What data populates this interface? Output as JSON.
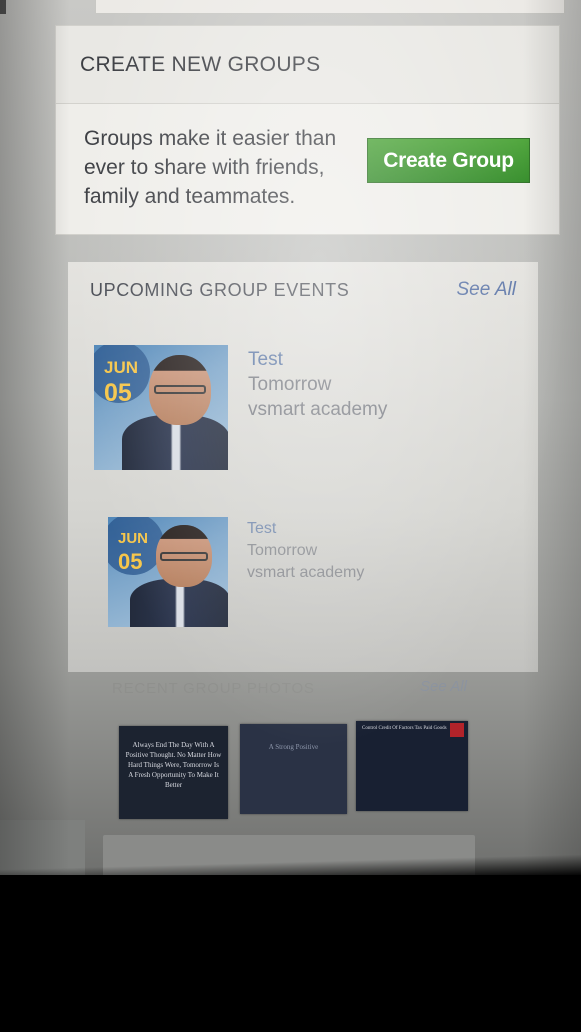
{
  "create_groups": {
    "title": "CREATE NEW GROUPS",
    "description": "Groups make it easier than ever to share with friends, family and teammates.",
    "button_label": "Create Group",
    "button_color": "#3a9a2c"
  },
  "events": {
    "title": "UPCOMING GROUP EVENTS",
    "see_all": "See All",
    "items": [
      {
        "month": "JUN",
        "day": "05",
        "name": "Test",
        "when": "Tomorrow",
        "group": "vsmart academy"
      },
      {
        "month": "JUN",
        "day": "05",
        "name": "Test",
        "when": "Tomorrow",
        "group": "vsmart academy"
      }
    ]
  },
  "photos": {
    "title": "RECENT GROUP PHOTOS",
    "see_all": "See All",
    "items": [
      {
        "caption": "Always End The Day With A Positive Thought. No Matter How Hard Things Were, Tomorrow Is A Fresh Opportunity To Make It Better"
      },
      {
        "caption": "A Strong Positive"
      },
      {
        "caption": "Control Credit Of Factors Tax Paid Goods"
      }
    ]
  },
  "colors": {
    "link": "#5f7aa7",
    "date_badge": "#f6c64a",
    "card_bg": "#ecebe7"
  }
}
